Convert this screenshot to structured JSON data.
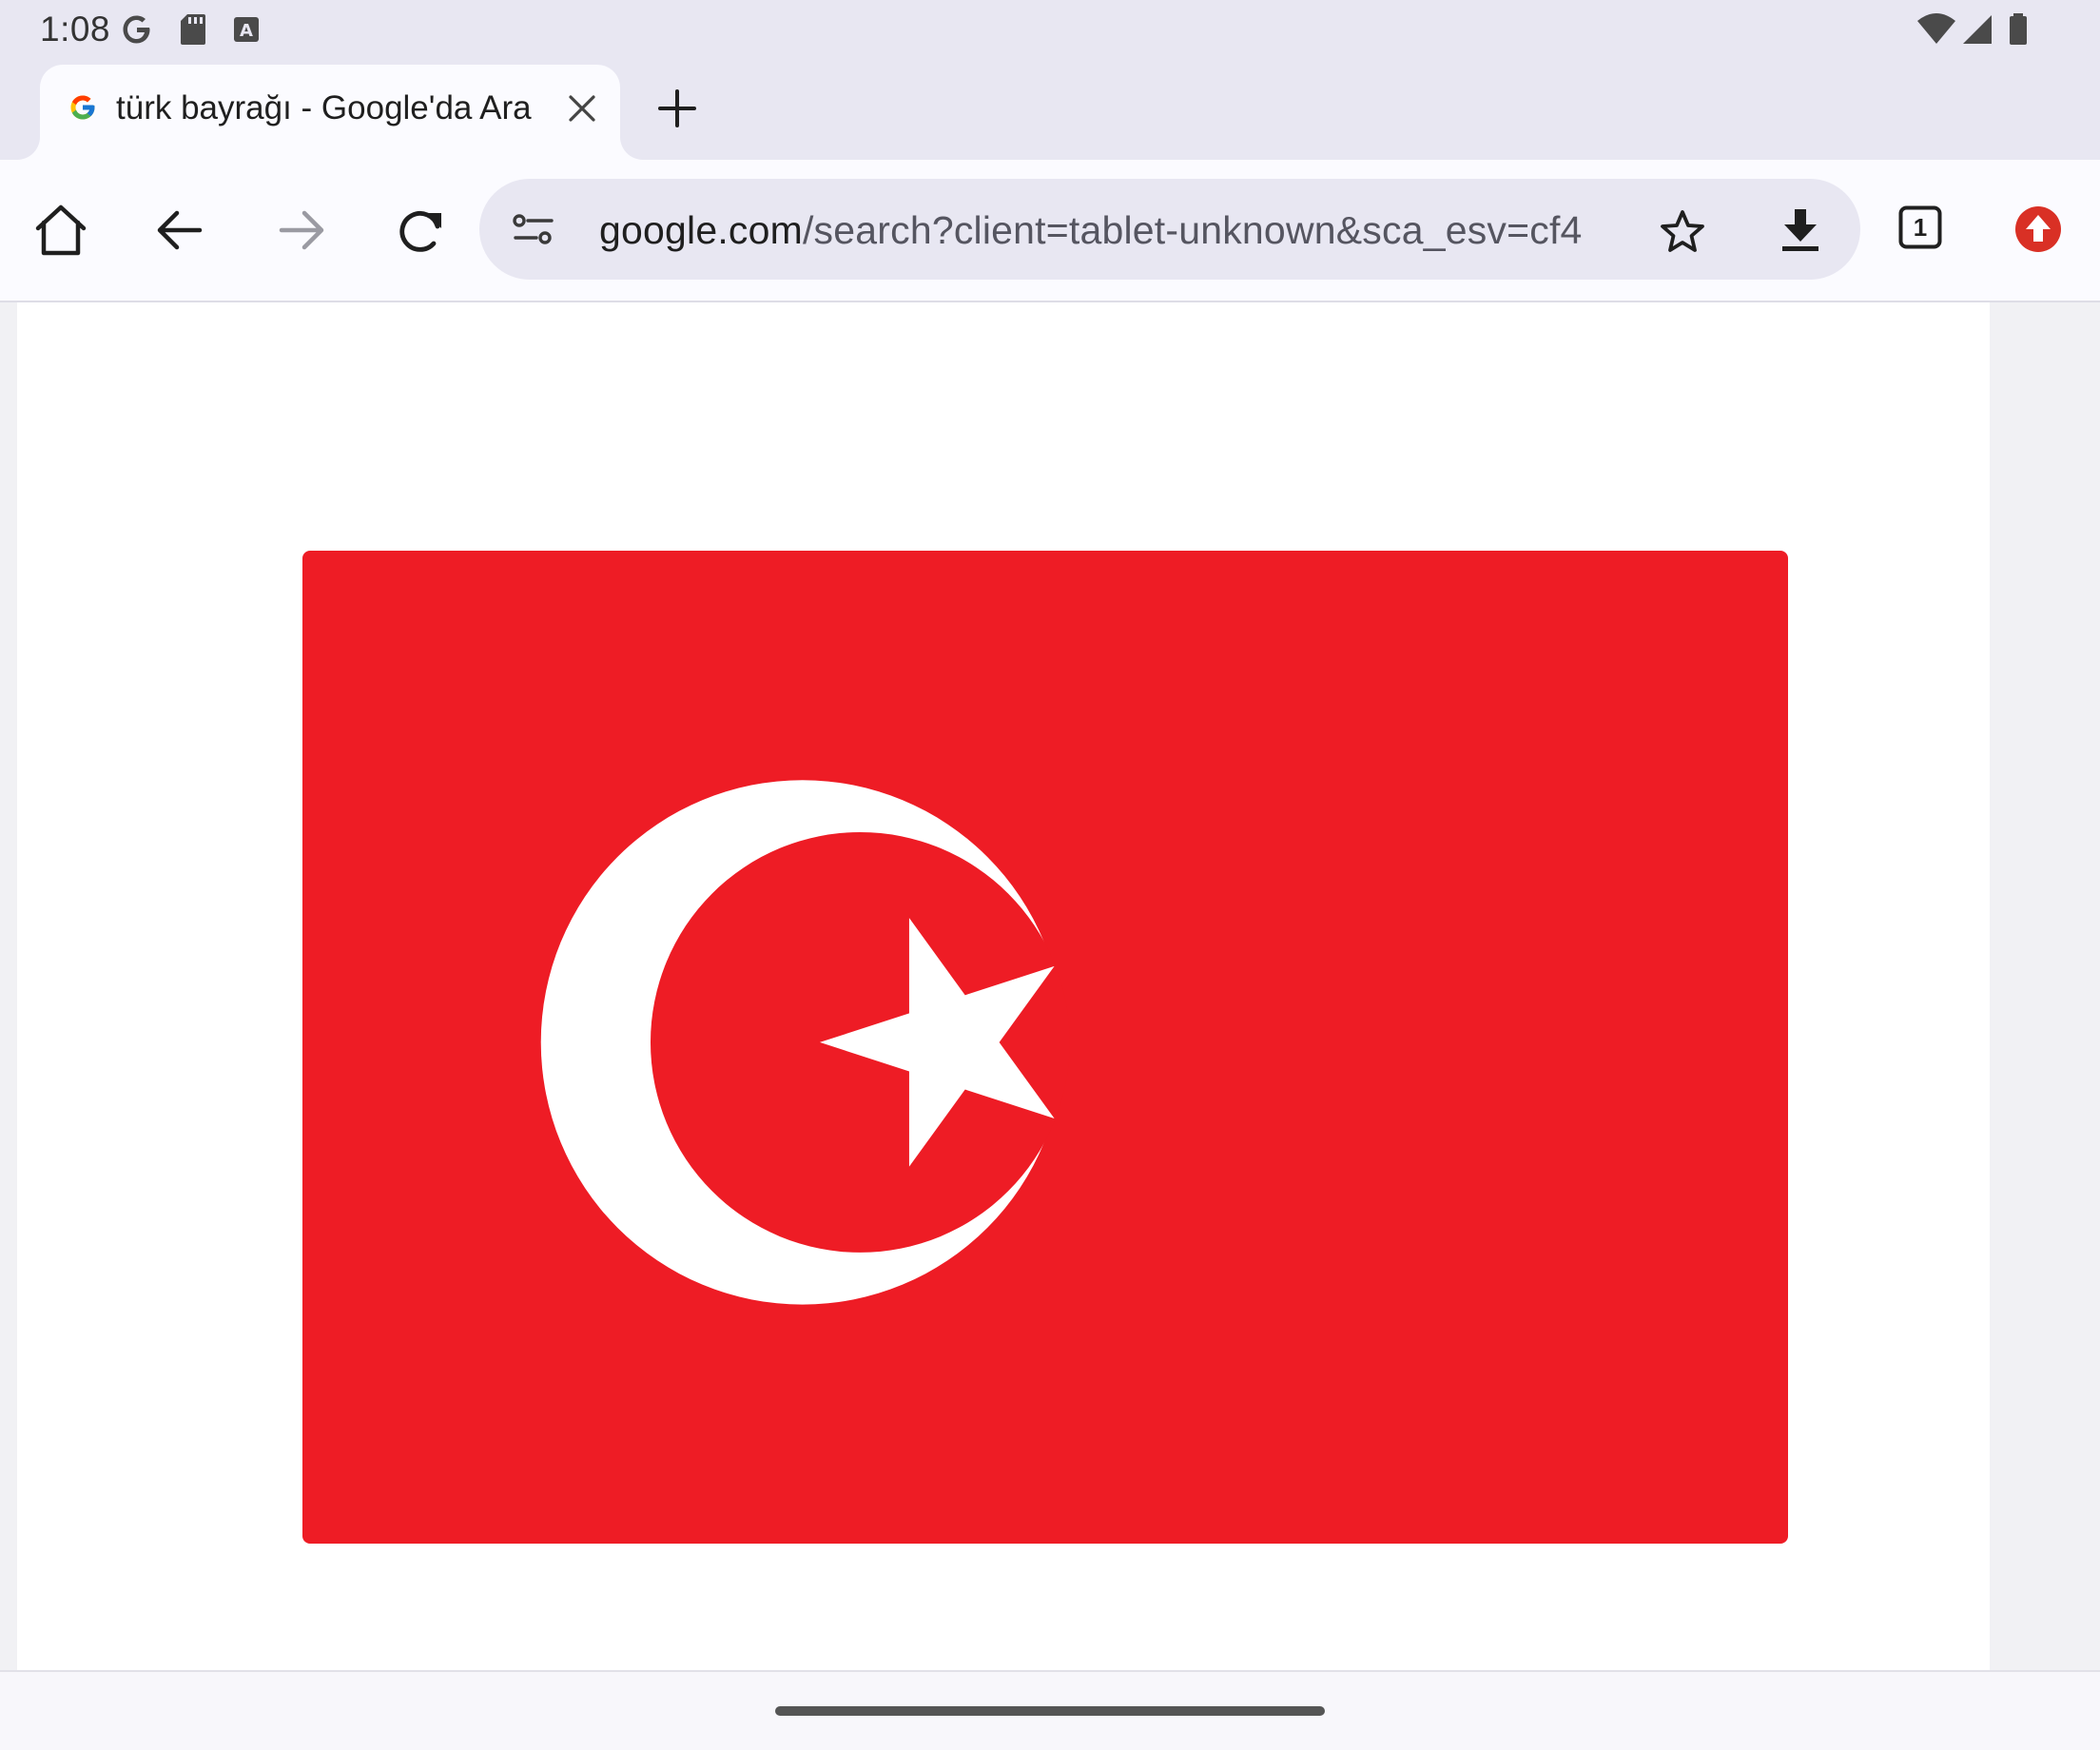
{
  "status_bar": {
    "time": "1:08",
    "left_icons": [
      "google-g-icon",
      "sd-card-icon",
      "keyboard-a-icon"
    ],
    "right_icons": [
      "wifi-icon",
      "signal-icon",
      "battery-icon"
    ]
  },
  "tabs": [
    {
      "title": "türk bayrağı - Google'da Ara",
      "favicon": "google-icon",
      "active": true
    }
  ],
  "toolbar": {
    "url_domain": "google.com",
    "url_path": "/search?client=tablet-unknown&sca_esv=cf4",
    "tab_count": "1",
    "buttons": [
      "home-icon",
      "back-icon",
      "forward-icon",
      "reload-icon",
      "site-settings-icon",
      "bookmark-star-icon",
      "download-icon",
      "tab-switcher-icon",
      "update-icon"
    ]
  },
  "content": {
    "image_subject": "turkish-flag",
    "colors": {
      "flag_red": "#ee1c25",
      "flag_white": "#ffffff",
      "update_badge": "#d93025",
      "chrome_bg": "#e8e7f2",
      "toolbar_bg": "#fbfbff"
    }
  }
}
